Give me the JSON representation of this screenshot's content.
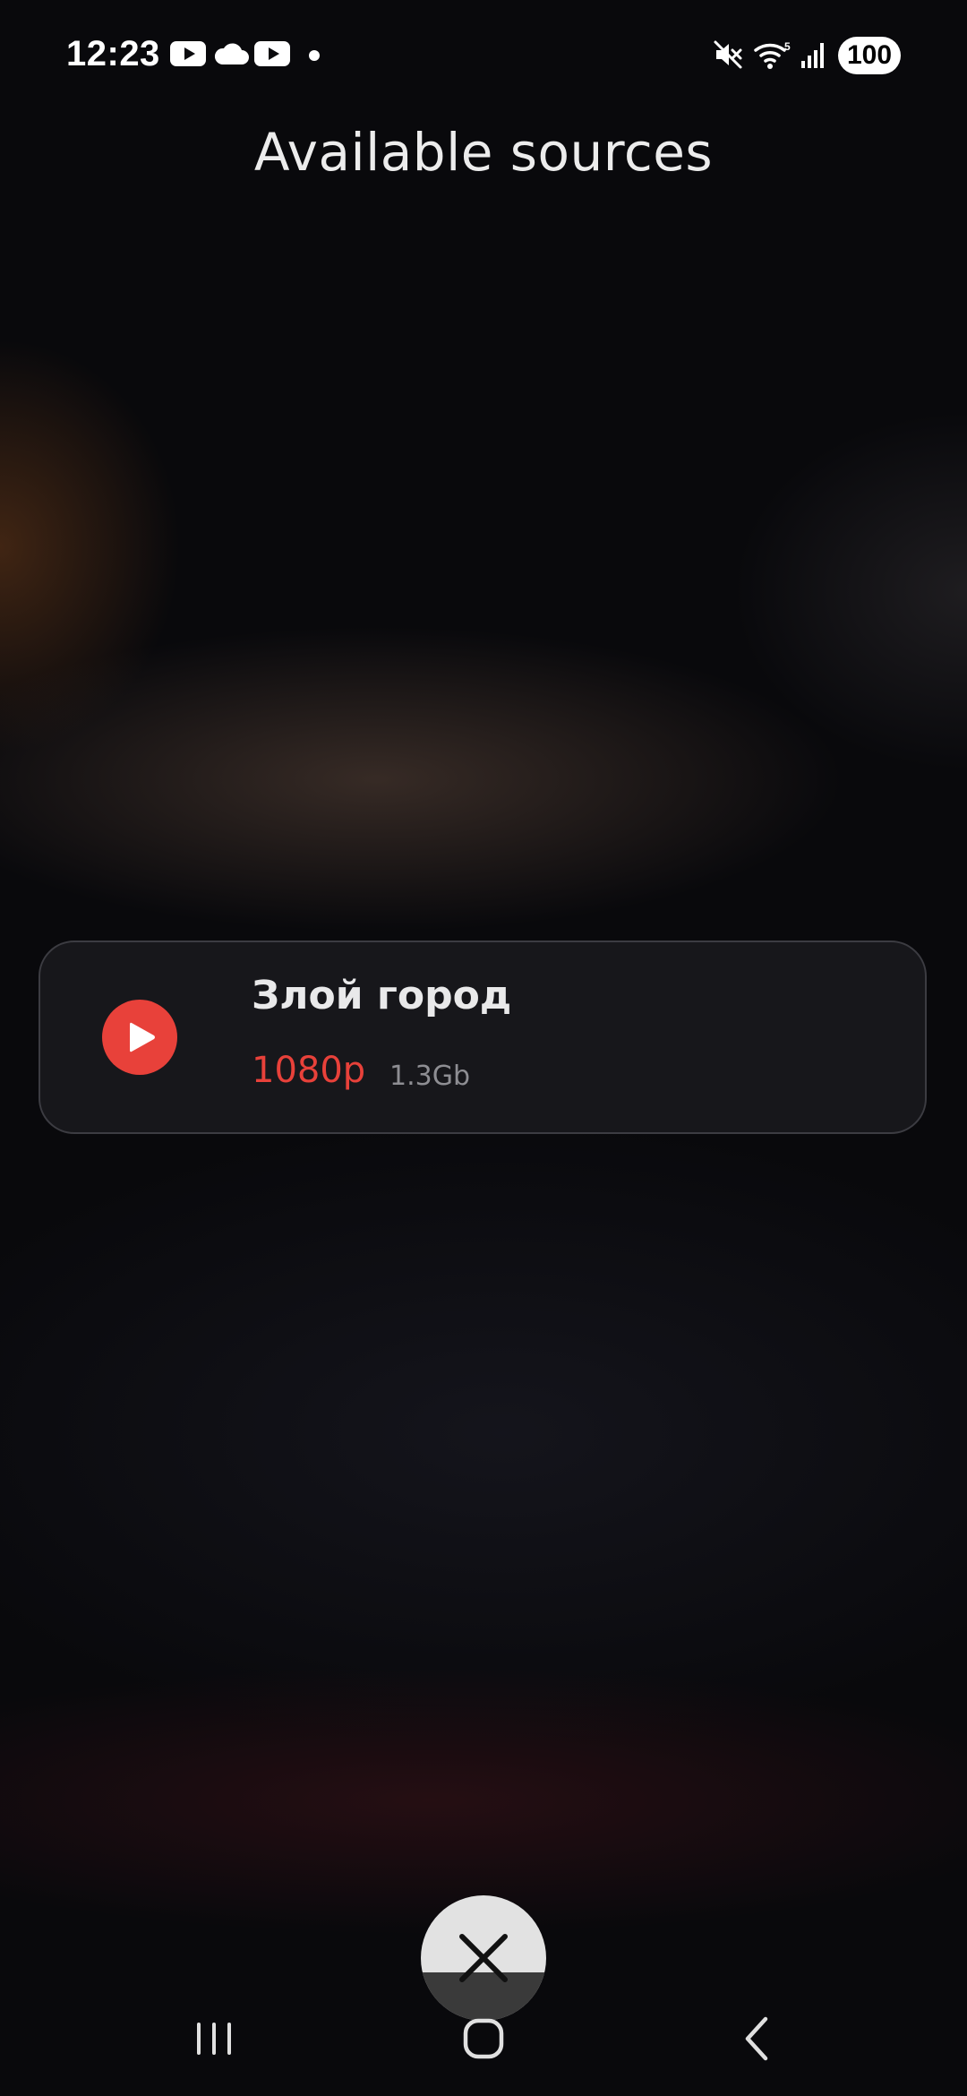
{
  "status_bar": {
    "time": "12:23",
    "battery": "100",
    "notification_icons": [
      "youtube-icon",
      "cloud-icon",
      "youtube-icon",
      "dot-icon"
    ],
    "system_icons": [
      "mute-icon",
      "wifi-icon",
      "signal-icon",
      "battery-icon"
    ]
  },
  "page": {
    "title": "Available sources"
  },
  "sources": [
    {
      "title": "Злой город",
      "quality": "1080p",
      "size": "1.3Gb",
      "icon": "play-icon"
    }
  ],
  "close": {
    "icon": "close-icon"
  },
  "navigation": {
    "icons": [
      "recent-apps-icon",
      "home-icon",
      "back-icon"
    ]
  },
  "colors": {
    "accent": "#e8413a",
    "background": "#0a0a0d",
    "card": "#18181c",
    "card_border": "#3c3c42",
    "muted_text": "#8e8e93"
  }
}
